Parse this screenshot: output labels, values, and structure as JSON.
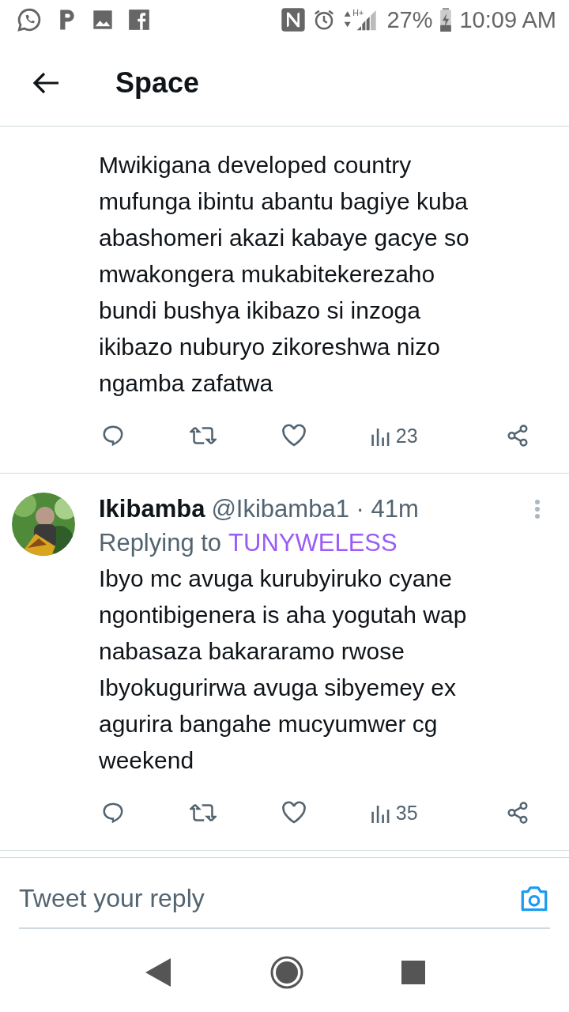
{
  "status_bar": {
    "network": "H+",
    "battery": "27%",
    "time": "10:09 AM"
  },
  "header": {
    "title": "Space"
  },
  "tweets": [
    {
      "kind": "continued",
      "lines": [
        "Mwikigana developed country",
        "mufunga ibintu abantu bagiye kuba",
        "abashomeri akazi kabaye gacye so",
        "mwakongera mukabitekerezaho",
        "bundi bushya ikibazo si inzoga",
        "ikibazo nuburyo zikoreshwa nizo",
        "ngamba zafatwa"
      ],
      "views": "23"
    },
    {
      "kind": "full",
      "name": "Ikibamba",
      "handle": "@Ikibamba1 · 41m",
      "replying_label": "Replying to",
      "replying_to": "TUNYWELESS",
      "lines": [
        "Ibyo mc avuga kurubyiruko cyane",
        "ngontibigenera is aha yogutah wap",
        "nabasaza bakararamo rwose",
        "Ibyokugurirwa avuga sibyemey ex",
        "agurira bangahe mucyumwer cg",
        "weekend"
      ],
      "views": "35"
    }
  ],
  "reply_bar": {
    "placeholder": "Tweet your reply"
  }
}
